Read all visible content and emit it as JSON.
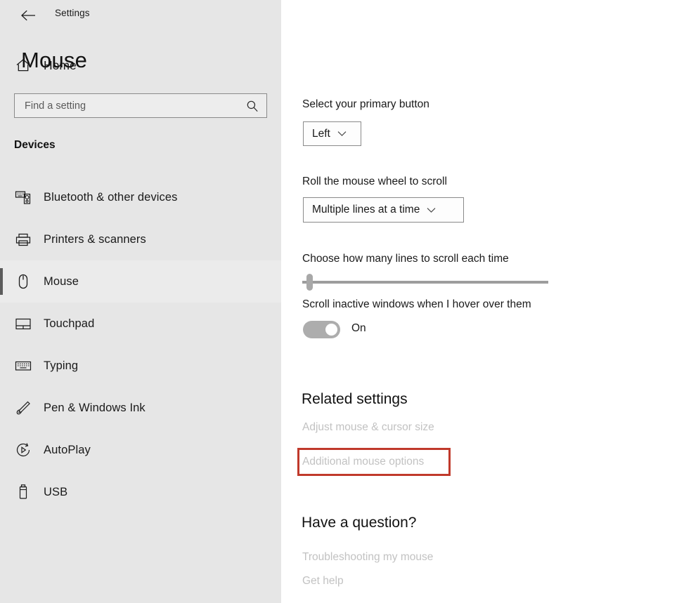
{
  "window": {
    "app_title": "Settings",
    "back_icon": "back-arrow-icon"
  },
  "sidebar": {
    "home": {
      "label": "Home",
      "icon": "home-icon"
    },
    "search": {
      "placeholder": "Find a setting",
      "value": "",
      "icon": "search-icon"
    },
    "section_label": "Devices",
    "items": [
      {
        "label": "Bluetooth & other devices",
        "icon": "bluetooth-devices-icon",
        "selected": false
      },
      {
        "label": "Printers & scanners",
        "icon": "printer-icon",
        "selected": false
      },
      {
        "label": "Mouse",
        "icon": "mouse-icon",
        "selected": true
      },
      {
        "label": "Touchpad",
        "icon": "touchpad-icon",
        "selected": false
      },
      {
        "label": "Typing",
        "icon": "keyboard-icon",
        "selected": false
      },
      {
        "label": "Pen & Windows Ink",
        "icon": "pen-icon",
        "selected": false
      },
      {
        "label": "AutoPlay",
        "icon": "autoplay-icon",
        "selected": false
      },
      {
        "label": "USB",
        "icon": "usb-icon",
        "selected": false
      }
    ]
  },
  "main": {
    "page_title": "Mouse",
    "primary_button": {
      "label": "Select your primary button",
      "value": "Left",
      "chevron_icon": "chevron-down-icon"
    },
    "wheel_scroll": {
      "label": "Roll the mouse wheel to scroll",
      "value": "Multiple lines at a time",
      "chevron_icon": "chevron-down-icon"
    },
    "lines_slider": {
      "label": "Choose how many lines to scroll each time",
      "percent": 2
    },
    "inactive_scroll": {
      "label": "Scroll inactive windows when I hover over them",
      "state": "On"
    },
    "related_settings": {
      "heading": "Related settings",
      "links": [
        "Adjust mouse & cursor size",
        "Additional mouse options"
      ]
    },
    "question": {
      "heading": "Have a question?",
      "links": [
        "Troubleshooting my mouse",
        "Get help"
      ]
    }
  },
  "annotations": {
    "color": "#c0392b",
    "targets": [
      "sidebar-item-mouse",
      "link-additional-mouse-options"
    ]
  }
}
